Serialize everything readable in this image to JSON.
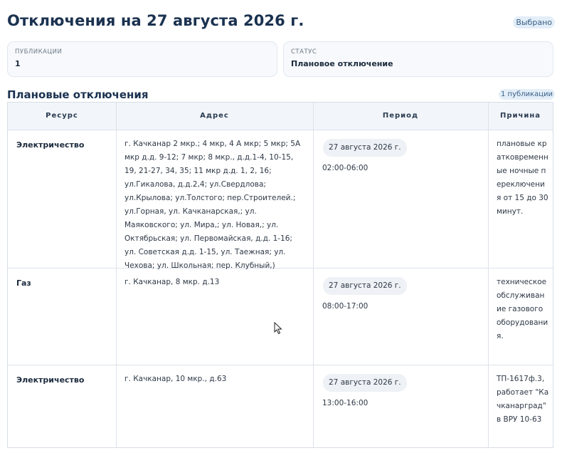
{
  "page": {
    "title": "Отключения на 27 августа 2026 г.",
    "badge": "Выбрано"
  },
  "cards": [
    {
      "caption": "Публикации",
      "value": "1"
    },
    {
      "caption": "Статус",
      "value": "Плановое отключение"
    }
  ],
  "section": {
    "title": "Плановые отключения",
    "count": "1 публикации"
  },
  "table": {
    "headers": [
      "Ресурс",
      "Адрес",
      "Период",
      "Причина"
    ],
    "rows": [
      {
        "resource": "Электричество",
        "address": "г. Качканар 2 мкр.; 4 мкр, 4 А мкр; 5 мкр; 5А мкр д.д. 9-12; 7 мкр; 8 мкр., д.д.1-4, 10-15, 19, 21-27, 34, 35; 11 мкр д.д. 1, 2, 16; ул.Гикалова, д.д.2,4; ул.Свердлова; ул.Крылова; ул.Толстого; пер.Строителей.; ул.Горная, ул. Качканарская,; ул. Маяковского; ул. Мира,; ул. Новая,; ул. Октябрьская; ул. Первомайская, д.д. 1-16; ул. Советская д.д. 1-15, ул. Таежная; ул. Чехова; ул. Школьная; пер. Клубный,)",
        "date": "27 августа 2026 г.",
        "time": "02:00-06:00",
        "reason": "плановые кратковременные ночные переключения от 15 до 30 минут."
      },
      {
        "resource": "Газ",
        "address": "г. Качканар, 8 мкр. д.13",
        "date": "27 августа 2026 г.",
        "time": "08:00-17:00",
        "reason": "техническое обслуживание газового оборудования."
      },
      {
        "resource": "Электричество",
        "address": "г. Качканар, 10 мкр., д.63",
        "date": "27 августа 2026 г.",
        "time": "13:00-16:00",
        "reason": "ТП-1617ф.3, работает \"Качканарград\" в ВРУ 10-63"
      }
    ]
  },
  "icons": {
    "cursor": "mouse-pointer-icon"
  }
}
